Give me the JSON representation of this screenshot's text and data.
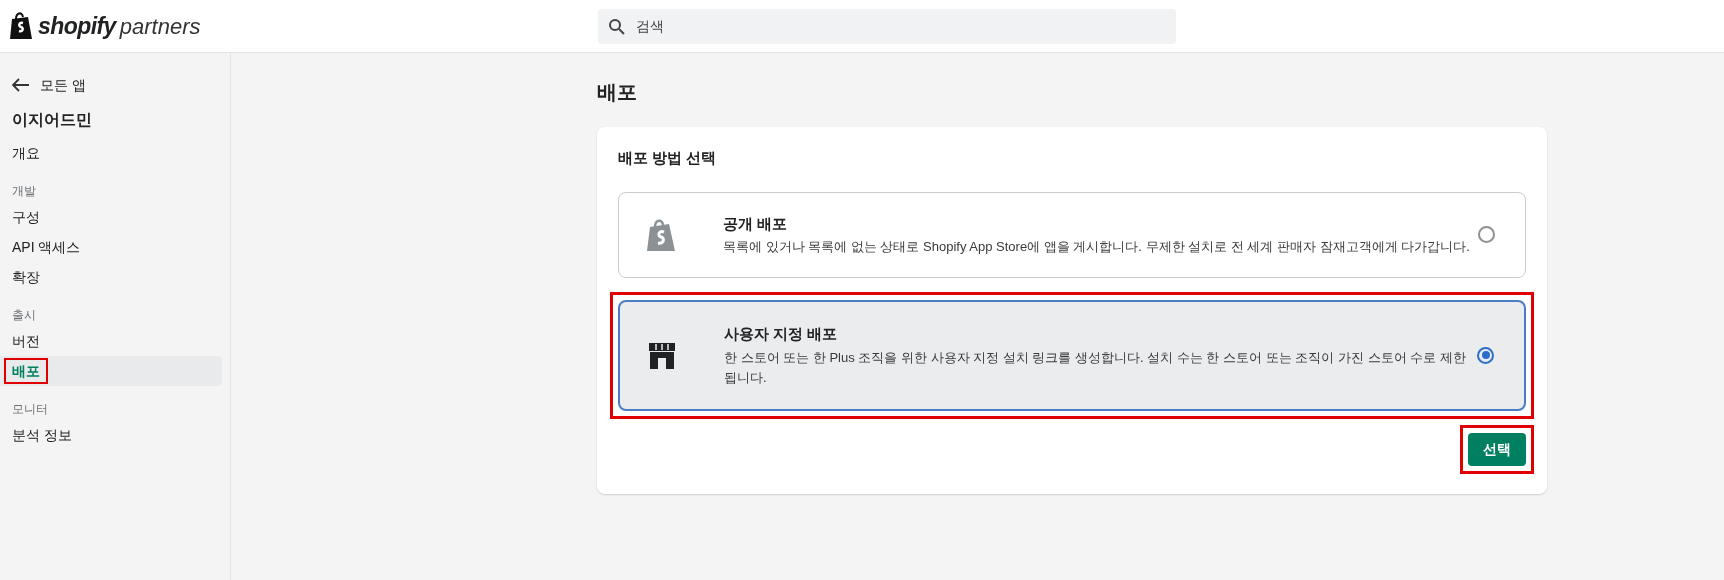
{
  "header": {
    "logo": {
      "brand": "shopify",
      "suffix": "partners"
    },
    "search": {
      "placeholder": "검색"
    }
  },
  "sidebar": {
    "back_link": "모든 앱",
    "app_name": "이지어드민",
    "sections": [
      {
        "items": [
          {
            "label": "개요",
            "selected": false,
            "highlighted": false
          }
        ]
      },
      {
        "heading": "개발",
        "items": [
          {
            "label": "구성",
            "selected": false,
            "highlighted": false
          },
          {
            "label": "API 액세스",
            "selected": false,
            "highlighted": false
          },
          {
            "label": "확장",
            "selected": false,
            "highlighted": false
          }
        ]
      },
      {
        "heading": "출시",
        "items": [
          {
            "label": "버전",
            "selected": false,
            "highlighted": false
          },
          {
            "label": "배포",
            "selected": true,
            "highlighted": true
          }
        ]
      },
      {
        "heading": "모니터",
        "items": [
          {
            "label": "분석 정보",
            "selected": false,
            "highlighted": false
          }
        ]
      }
    ]
  },
  "page": {
    "title": "배포",
    "card": {
      "title": "배포 방법 선택",
      "options": [
        {
          "kind": "bag",
          "title": "공개 배포",
          "description": "목록에 있거나 목록에 없는 상태로 Shopify App Store에 앱을 게시합니다. 무제한 설치로 전 세계 판매자 잠재고객에게 다가갑니다.",
          "selected": false,
          "highlighted": false
        },
        {
          "kind": "store",
          "title": "사용자 지정 배포",
          "description": "한 스토어 또는 한 Plus 조직을 위한 사용자 지정 설치 링크를 생성합니다. 설치 수는 한 스토어 또는 조직이 가진 스토어 수로 제한됩니다.",
          "selected": true,
          "highlighted": true
        }
      ],
      "button": {
        "label": "선택",
        "highlighted": true
      }
    }
  }
}
